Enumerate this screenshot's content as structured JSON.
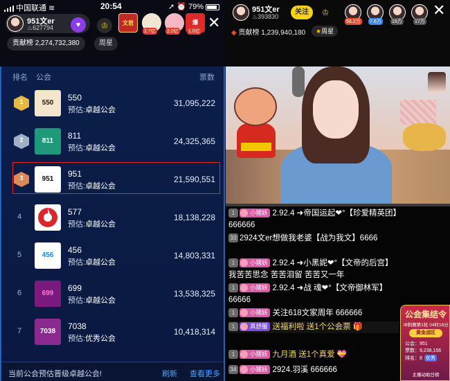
{
  "left": {
    "status": {
      "carrier": "中国联通",
      "time": "20:54",
      "battery": "79%"
    },
    "host": {
      "name": "951文er",
      "fans": "627794"
    },
    "badges": [
      "文君",
      "2.7亿",
      "2.0亿",
      "1.0亿"
    ],
    "contribution": "贡献榜 2,274,732,380",
    "week_star": "周星",
    "table": {
      "header": {
        "rank": "排名",
        "guild": "公会",
        "votes": "票数"
      },
      "rows": [
        {
          "rank": "1",
          "logo": "550",
          "name": "550",
          "pred_prefix": "预估:",
          "pred": "卓越公会",
          "votes": "31,095,222"
        },
        {
          "rank": "2",
          "logo": "811",
          "name": "811",
          "pred_prefix": "预估:",
          "pred": "卓越公会",
          "votes": "24,325,365"
        },
        {
          "rank": "3",
          "logo": "951",
          "name": "951",
          "pred_prefix": "预估:",
          "pred": "卓越公会",
          "votes": "21,590,551"
        },
        {
          "rank": "4",
          "logo": "",
          "name": "577",
          "pred_prefix": "预估:",
          "pred": "卓越公会",
          "votes": "18,138,228"
        },
        {
          "rank": "5",
          "logo": "456",
          "name": "456",
          "pred_prefix": "预估:",
          "pred": "卓越公会",
          "votes": "14,803,331"
        },
        {
          "rank": "6",
          "logo": "699",
          "name": "699",
          "pred_prefix": "预估:",
          "pred": "卓越公会",
          "votes": "13,538,325"
        },
        {
          "rank": "7",
          "logo": "7038",
          "name": "7038",
          "pred_prefix": "预估:",
          "pred": "优秀公会",
          "votes": "10,418,314"
        }
      ]
    },
    "footer": {
      "text": "当前公会预估晋级卓越公会!",
      "refresh": "刷新",
      "more": "查看更多"
    }
  },
  "right": {
    "host": {
      "name": "951文er",
      "fans": "393830"
    },
    "follow": "关注",
    "viewer_badges": [
      "58.2万",
      "7.6万",
      "19万",
      "17万"
    ],
    "contribution": "贡献榜 1,239,940,180",
    "week_star": "周星",
    "chat": [
      {
        "lv": "1",
        "tag": "小猪妖",
        "text": "2.92.4 ➜帝国运起❤°【珍爱精英团】666666"
      },
      {
        "lv": "33",
        "tag": "",
        "text": "2924文er想做我老婆【战为我文】6666"
      },
      {
        "lv": "1",
        "tag": "小猪妖",
        "text": "2.92.4 ➜小黑妮❤°【文帝的后宫】我苦苦思念 苦苦泪留 苦苦又一年"
      },
      {
        "lv": "1",
        "tag": "小猪妖",
        "text": "2.92.4 ➜战 魂❤°【文帝御林军】 66666"
      },
      {
        "lv": "1",
        "tag": "小猪妖",
        "text": "关注618文家周年 666666"
      },
      {
        "lv": "1",
        "tag": "真舒服",
        "text": "送福利啦 送1个公会票"
      },
      {
        "lv": "1",
        "tag": "小猪妖",
        "text": "九月酒 送1个真爱"
      },
      {
        "lv": "34",
        "tag": "小猪妖",
        "text": "2924.羽溪 666666"
      }
    ],
    "card": {
      "title": "公会集结令",
      "sub": "冲刺赛第1轮 04时16分",
      "zone": "黄金战区",
      "guild": "公会：951",
      "votes": "票数：9,238,156",
      "rank": "排名：8",
      "rank_tag": "优秀",
      "speed": "主播动助日榜"
    }
  }
}
